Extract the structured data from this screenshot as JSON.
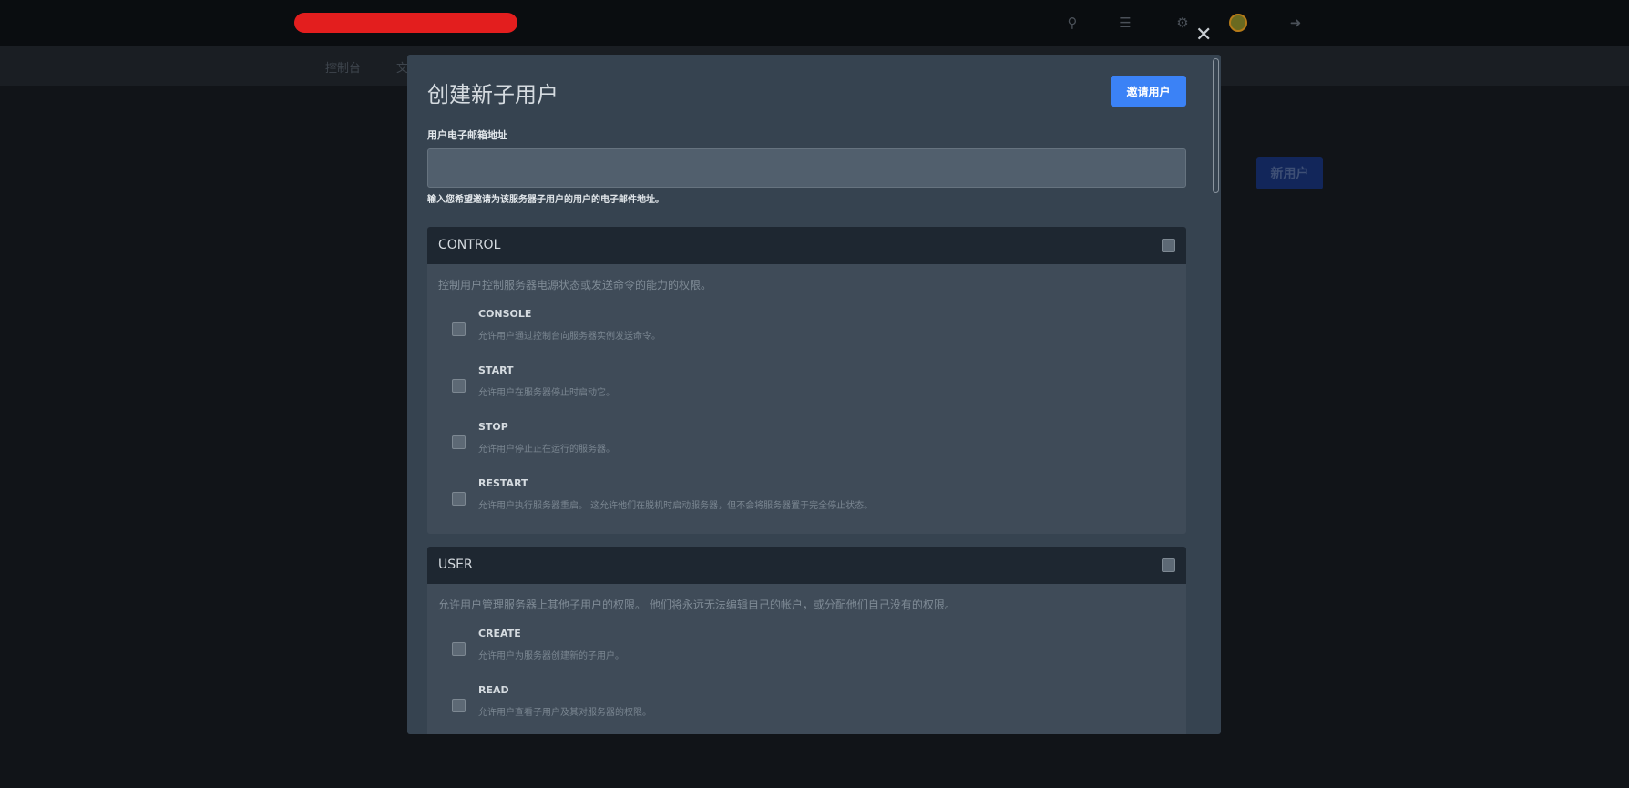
{
  "topbar": {
    "icons": [
      "search-icon",
      "layers-icon",
      "cogs-icon",
      "avatar",
      "sign-out-icon"
    ]
  },
  "nav": {
    "items": [
      "控制台",
      "文"
    ]
  },
  "page": {
    "new_user_button": "新用户"
  },
  "modal": {
    "title": "创建新子用户",
    "invite_button": "邀请用户",
    "email_label": "用户电子邮箱地址",
    "email_value": "",
    "email_help": "输入您希望邀请为该服务器子用户的用户的电子邮件地址。",
    "panels": [
      {
        "title": "CONTROL",
        "description": "控制用户控制服务器电源状态或发送命令的能力的权限。",
        "items": [
          {
            "title": "CONSOLE",
            "description": "允许用户通过控制台向服务器实例发送命令。"
          },
          {
            "title": "START",
            "description": "允许用户在服务器停止时启动它。"
          },
          {
            "title": "STOP",
            "description": "允许用户停止正在运行的服务器。"
          },
          {
            "title": "RESTART",
            "description": "允许用户执行服务器重启。 这允许他们在脱机时启动服务器，但不会将服务器置于完全停止状态。"
          }
        ]
      },
      {
        "title": "USER",
        "description": "允许用户管理服务器上其他子用户的权限。 他们将永远无法编辑自己的帐户，或分配他们自己没有的权限。",
        "items": [
          {
            "title": "CREATE",
            "description": "允许用户为服务器创建新的子用户。"
          },
          {
            "title": "READ",
            "description": "允许用户查看子用户及其对服务器的权限。"
          }
        ]
      }
    ]
  },
  "colors": {
    "accent": "#3b82f6",
    "modal_bg": "#364350",
    "panel_header": "#1e2731"
  }
}
